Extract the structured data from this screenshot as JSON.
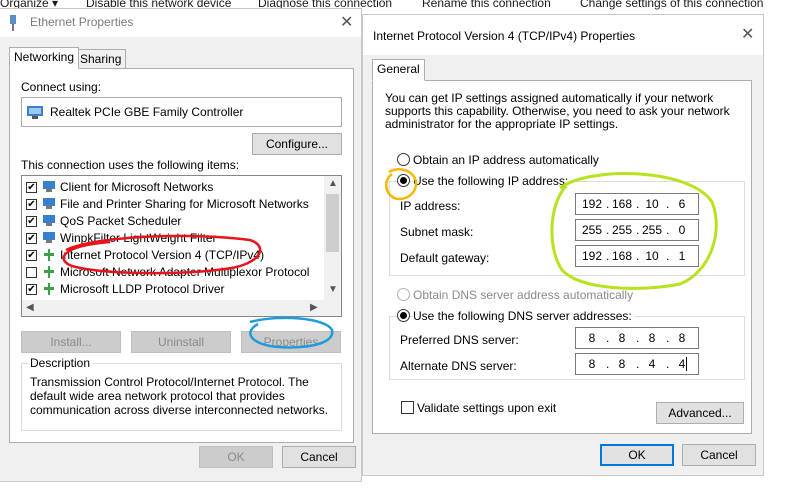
{
  "explorer_bar": {
    "organize": "Organize ▾",
    "disable": "Disable this network device",
    "diagnose": "Diagnose this connection",
    "rename": "Rename this connection",
    "change": "Change settings of this connection"
  },
  "ethernet": {
    "title": "Ethernet Properties",
    "tabs": [
      "Networking",
      "Sharing"
    ],
    "connect_using_label": "Connect using:",
    "adapter_name": "Realtek PCIe GBE Family Controller",
    "configure_button": "Configure...",
    "items_label": "This connection uses the following items:",
    "items": [
      {
        "label": "Client for Microsoft Networks",
        "checked": true
      },
      {
        "label": "File and Printer Sharing for Microsoft Networks",
        "checked": true
      },
      {
        "label": "QoS Packet Scheduler",
        "checked": true
      },
      {
        "label": "WinpkFilter LightWeight Filter",
        "checked": true
      },
      {
        "label": "Internet Protocol Version 4 (TCP/IPv4)",
        "checked": true
      },
      {
        "label": "Microsoft Network Adapter Multiplexor Protocol",
        "checked": false
      },
      {
        "label": "Microsoft LLDP Protocol Driver",
        "checked": true
      }
    ],
    "install_button": "Install...",
    "uninstall_button": "Uninstall",
    "properties_button": "Properties",
    "description_label": "Description",
    "description_text": "Transmission Control Protocol/Internet Protocol. The default wide area network protocol that provides communication across diverse interconnected networks.",
    "ok_button": "OK",
    "cancel_button": "Cancel"
  },
  "ipv4": {
    "title": "Internet Protocol Version 4 (TCP/IPv4) Properties",
    "tab": "General",
    "intro": "You can get IP settings assigned automatically if your network supports this capability. Otherwise, you need to ask your network administrator for the appropriate IP settings.",
    "auto_ip_label": "Obtain an IP address automatically",
    "manual_ip_label": "Use the following IP address:",
    "ip_label": "IP address:",
    "ip": [
      "192",
      "168",
      "10",
      "6"
    ],
    "mask_label": "Subnet mask:",
    "mask": [
      "255",
      "255",
      "255",
      "0"
    ],
    "gateway_label": "Default gateway:",
    "gateway": [
      "192",
      "168",
      "10",
      "1"
    ],
    "auto_dns_label": "Obtain DNS server address automatically",
    "manual_dns_label": "Use the following DNS server addresses:",
    "preferred_label": "Preferred DNS server:",
    "preferred": [
      "8",
      "8",
      "8",
      "8"
    ],
    "alternate_label": "Alternate DNS server:",
    "alternate": [
      "8",
      "8",
      "4",
      "4"
    ],
    "validate_label": "Validate settings upon exit",
    "advanced_button": "Advanced...",
    "ok_button": "OK",
    "cancel_button": "Cancel"
  },
  "colors": {
    "annotation_red": "#e8141c",
    "annotation_blue": "#1e9be0",
    "annotation_yellow": "#f5b800",
    "annotation_green": "#b6e21e",
    "accent": "#0078d7"
  }
}
